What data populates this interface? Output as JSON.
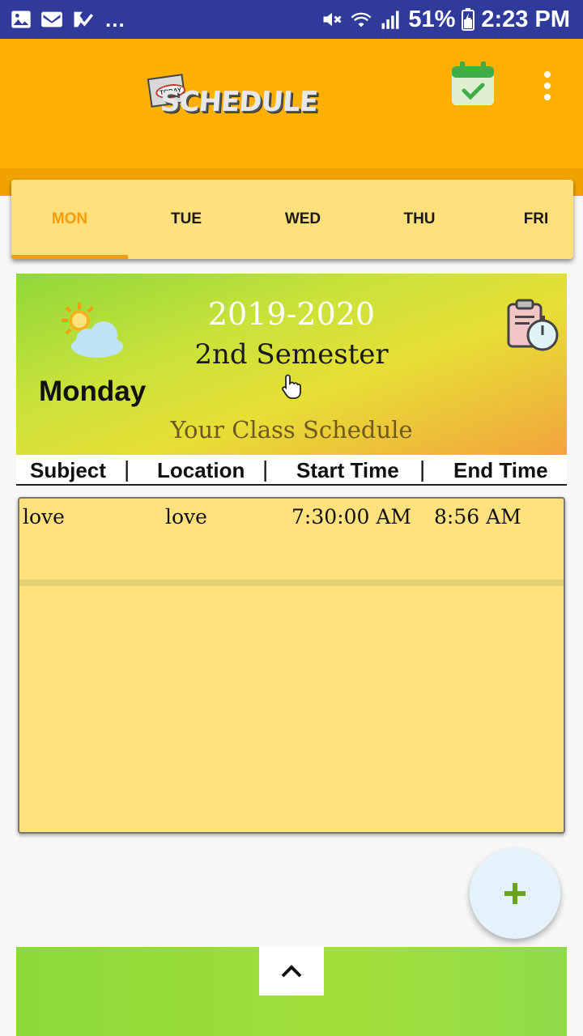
{
  "status_bar": {
    "overflow": "...",
    "battery": "51%",
    "time": "2:23 PM"
  },
  "app_bar": {
    "logo_today": "TODAY",
    "logo_text": "SCHEDULE"
  },
  "tabs": [
    {
      "label": "MON",
      "active": true
    },
    {
      "label": "TUE",
      "active": false
    },
    {
      "label": "WED",
      "active": false
    },
    {
      "label": "THU",
      "active": false
    },
    {
      "label": "FRI",
      "active": false
    }
  ],
  "hero": {
    "day": "Monday",
    "year": "2019-2020",
    "semester": "2nd Semester",
    "subtitle": "Your Class Schedule"
  },
  "columns": {
    "subject": "Subject",
    "location": "Location",
    "start_time": "Start Time",
    "end_time": "End Time",
    "separator": "|"
  },
  "schedule": [
    {
      "subject": "love",
      "location": "love",
      "start": "7:30:00 AM",
      "end": "8:56 AM"
    }
  ],
  "fab": {
    "icon": "plus-icon"
  },
  "colors": {
    "status_bar": "#2f3a9a",
    "app_bar": "#ffb000",
    "tab_bg": "#ffe07a",
    "tab_active": "#f39c12",
    "card_bg": "#ffe27e",
    "fab_bg": "#e3f2fb",
    "fab_icon": "#6aa31c"
  }
}
